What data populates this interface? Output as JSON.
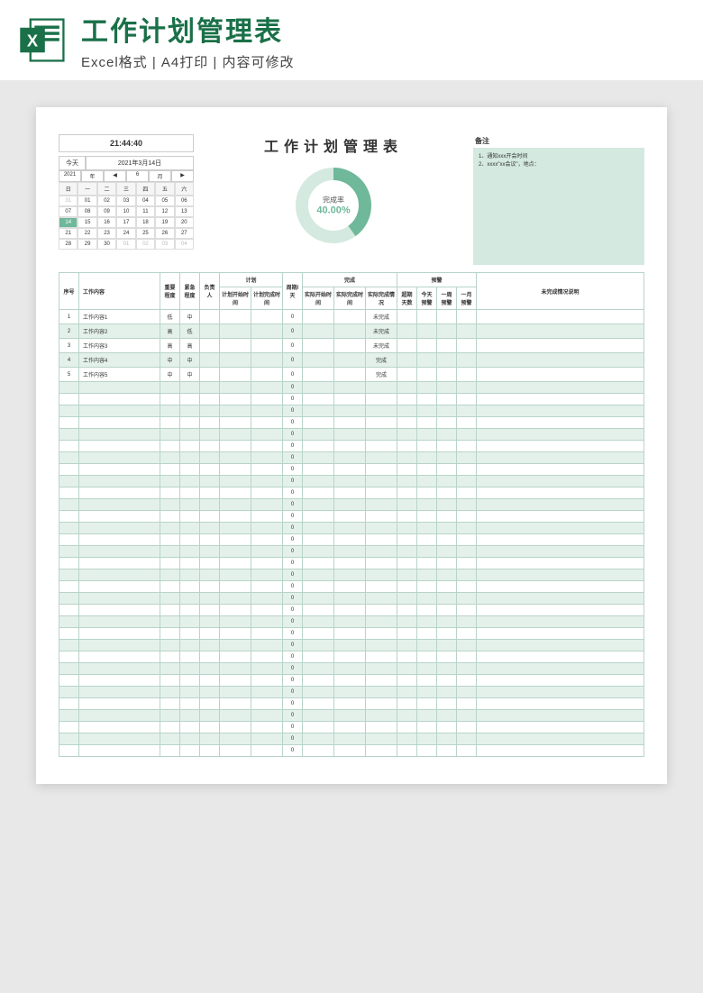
{
  "banner": {
    "title": "工作计划管理表",
    "subtitle": "Excel格式 | A4打印 | 内容可修改"
  },
  "clock": "21:44:40",
  "today_label": "今天",
  "today_value": "2021年3月14日",
  "year_controls": [
    "2021",
    "年",
    "◀",
    "6",
    "月",
    "▶"
  ],
  "cal_headers": [
    "日",
    "一",
    "二",
    "三",
    "四",
    "五",
    "六"
  ],
  "cal_days": [
    {
      "d": "31",
      "dim": true
    },
    {
      "d": "01"
    },
    {
      "d": "02"
    },
    {
      "d": "03"
    },
    {
      "d": "04"
    },
    {
      "d": "05"
    },
    {
      "d": "06"
    },
    {
      "d": "07"
    },
    {
      "d": "08"
    },
    {
      "d": "09"
    },
    {
      "d": "10"
    },
    {
      "d": "11"
    },
    {
      "d": "12"
    },
    {
      "d": "13"
    },
    {
      "d": "14",
      "today": true
    },
    {
      "d": "15"
    },
    {
      "d": "16"
    },
    {
      "d": "17"
    },
    {
      "d": "18"
    },
    {
      "d": "19"
    },
    {
      "d": "20"
    },
    {
      "d": "21"
    },
    {
      "d": "22"
    },
    {
      "d": "23"
    },
    {
      "d": "24"
    },
    {
      "d": "25"
    },
    {
      "d": "26"
    },
    {
      "d": "27"
    },
    {
      "d": "28"
    },
    {
      "d": "29"
    },
    {
      "d": "30"
    },
    {
      "d": "01",
      "dim": true
    },
    {
      "d": "02",
      "dim": true
    },
    {
      "d": "03",
      "dim": true
    },
    {
      "d": "04",
      "dim": true
    }
  ],
  "main_title": "工作计划管理表",
  "chart_data": {
    "type": "pie",
    "title": "完成率",
    "value_label": "40.00%",
    "values": [
      40,
      60
    ],
    "categories": [
      "完成",
      "未完成"
    ],
    "colors": [
      "#6fb89a",
      "#d4e9df"
    ]
  },
  "notes": {
    "header": "备注",
    "lines": [
      "1、通知xxx开会时间",
      "2、xxxx\"xx会议\"，地点："
    ]
  },
  "columns": {
    "seq": "序号",
    "content": "工作内容",
    "importance": "重要程度",
    "urgency": "紧急程度",
    "owner": "负责人",
    "plan_group": "计划",
    "plan_start": "计划开始时间",
    "plan_end": "计划完成时间",
    "cycle": "周期/天",
    "done_group": "完成",
    "act_start": "实际开始时间",
    "act_end": "实际完成时间",
    "status": "实际完成情况",
    "warn_group": "预警",
    "overdue": "超期天数",
    "today_w": "今天预警",
    "week_w": "一周预警",
    "month_w": "一月预警",
    "explain": "未完成情况说明"
  },
  "rows": [
    {
      "seq": "1",
      "content": "工作内容1",
      "imp": "低",
      "urg": "中",
      "cycle": "0",
      "status": "未完成"
    },
    {
      "seq": "2",
      "content": "工作内容2",
      "imp": "高",
      "urg": "低",
      "cycle": "0",
      "status": "未完成"
    },
    {
      "seq": "3",
      "content": "工作内容3",
      "imp": "高",
      "urg": "高",
      "cycle": "0",
      "status": "未完成"
    },
    {
      "seq": "4",
      "content": "工作内容4",
      "imp": "中",
      "urg": "中",
      "cycle": "0",
      "status": "完成"
    },
    {
      "seq": "5",
      "content": "工作内容5",
      "imp": "中",
      "urg": "中",
      "cycle": "0",
      "status": "完成"
    }
  ],
  "empty_rows": 32,
  "empty_cycle": "0"
}
